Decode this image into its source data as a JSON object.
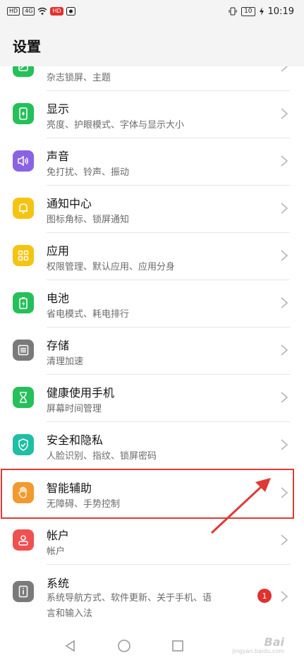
{
  "status_bar": {
    "chips": [
      "HD",
      "4G",
      "HD"
    ],
    "battery": "10",
    "time": "10:19"
  },
  "header": {
    "title": "设置"
  },
  "items": [
    {
      "name": "theme",
      "title": "",
      "subtitle": "杂志锁屏、主题",
      "icon": "theme-icon",
      "color": "#25c05a"
    },
    {
      "name": "display",
      "title": "显示",
      "subtitle": "亮度、护眼模式、字体与显示大小",
      "icon": "display-icon",
      "color": "#25c05a"
    },
    {
      "name": "sound",
      "title": "声音",
      "subtitle": "免打扰、铃声、振动",
      "icon": "sound-icon",
      "color": "#8a63e3"
    },
    {
      "name": "notification",
      "title": "通知中心",
      "subtitle": "图标角标、锁屏通知",
      "icon": "bell-icon",
      "color": "#f5c412"
    },
    {
      "name": "apps",
      "title": "应用",
      "subtitle": "权限管理、默认应用、应用分身",
      "icon": "apps-icon",
      "color": "#f5c412"
    },
    {
      "name": "battery",
      "title": "电池",
      "subtitle": "省电模式、耗电排行",
      "icon": "battery-icon",
      "color": "#25c05a"
    },
    {
      "name": "storage",
      "title": "存储",
      "subtitle": "清理加速",
      "icon": "storage-icon",
      "color": "#7a7a7a"
    },
    {
      "name": "digital-balance",
      "title": "健康使用手机",
      "subtitle": "屏幕时间管理",
      "icon": "hourglass-icon",
      "color": "#25c05a"
    },
    {
      "name": "security",
      "title": "安全和隐私",
      "subtitle": "人脸识别、指纹、锁屏密码",
      "icon": "shield-icon",
      "color": "#1fbfa4"
    },
    {
      "name": "smart-assist",
      "title": "智能辅助",
      "subtitle": "无障碍、手势控制",
      "icon": "hand-icon",
      "color": "#f29a2e"
    },
    {
      "name": "accounts",
      "title": "帐户",
      "subtitle": "帐户",
      "icon": "account-icon",
      "color": "#ef5150"
    },
    {
      "name": "system",
      "title": "系统",
      "subtitle": "系统导航方式、软件更新、关于手机、语",
      "subtitle2": "言和输入法",
      "icon": "system-icon",
      "color": "#7a7a7a",
      "badge": "1"
    }
  ],
  "nav": {
    "back": "back-icon",
    "home": "home-icon",
    "recent": "recent-icon"
  },
  "watermark": {
    "text": "Bai",
    "sub": "jingyan.baidu.com"
  }
}
